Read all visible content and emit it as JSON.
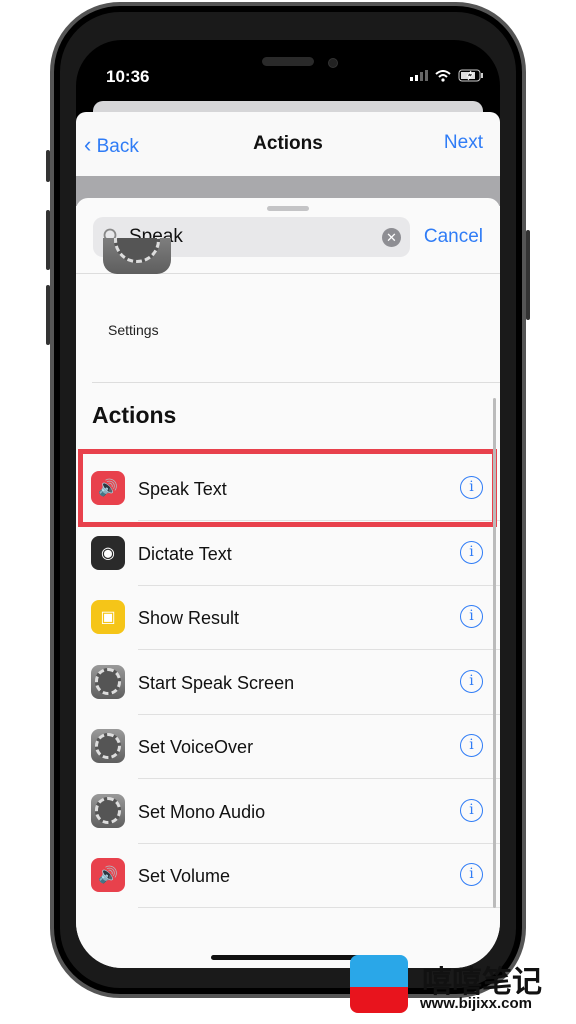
{
  "status": {
    "time": "10:36"
  },
  "nav": {
    "back": "Back",
    "title": "Actions",
    "next": "Next"
  },
  "search": {
    "value": "Speak",
    "cancel": "Cancel"
  },
  "apps": [
    {
      "label": "Settings"
    }
  ],
  "section": "Actions",
  "actions": [
    {
      "label": "Speak Text",
      "icon": "speaker-icon",
      "color": "#e8414c",
      "highlighted": true
    },
    {
      "label": "Dictate Text",
      "icon": "record-icon",
      "color": "#2a2a2a"
    },
    {
      "label": "Show Result",
      "icon": "result-icon",
      "color": "#f5c518"
    },
    {
      "label": "Start Speak Screen",
      "icon": "gear-icon",
      "color": "#777777"
    },
    {
      "label": "Set VoiceOver",
      "icon": "gear-icon",
      "color": "#777777"
    },
    {
      "label": "Set Mono Audio",
      "icon": "gear-icon",
      "color": "#777777"
    },
    {
      "label": "Set Volume",
      "icon": "speaker-icon",
      "color": "#e8414c"
    }
  ],
  "watermark": {
    "title": "嘻嘻笔记",
    "url": "www.bijixx.com"
  }
}
